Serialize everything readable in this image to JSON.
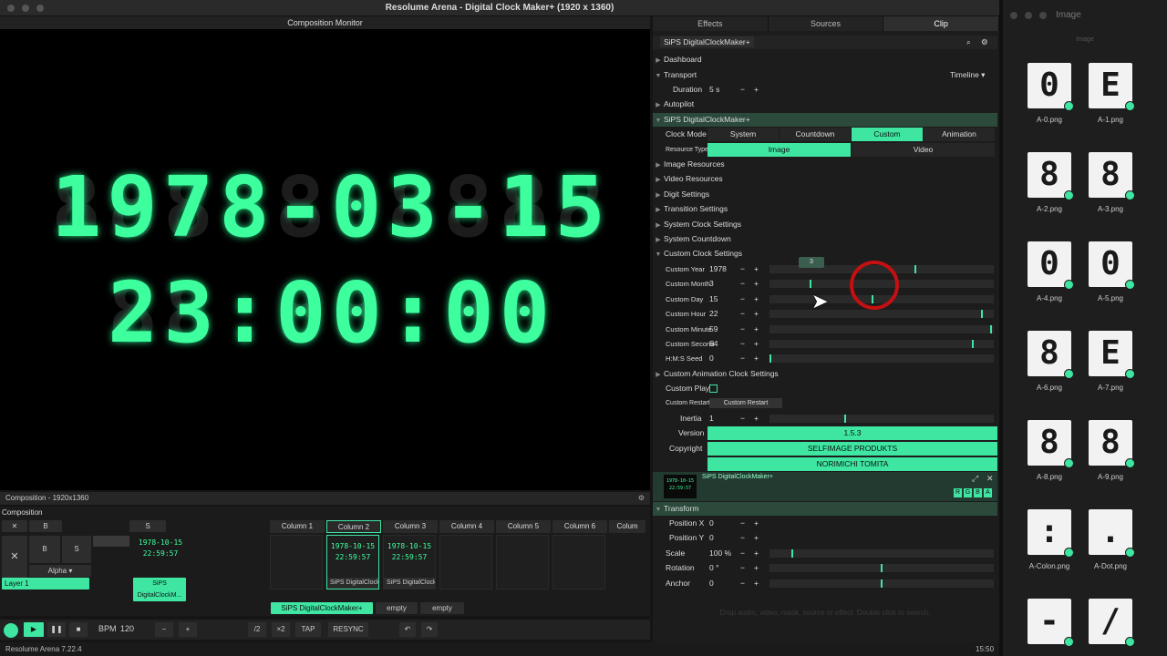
{
  "window_title": "Resolume Arena - Digital Clock Maker+ (1920 x 1360)",
  "monitor": {
    "title": "Composition Monitor",
    "line1": "1978-03-15",
    "line2": "23:00:00",
    "ghost1": "8888888888",
    "ghost2": "88:88:88"
  },
  "composition": {
    "header": "Composition - 1920x1360",
    "label": "Composition",
    "layer": "Layer 1",
    "blend": "Alpha"
  },
  "columns": [
    "Column 1",
    "Column 2",
    "Column 3",
    "Column 4",
    "Column 5",
    "Column 6",
    "Colum"
  ],
  "clips": [
    {
      "line1": "1978-10-15",
      "line2": "22:59:57",
      "name": "SiPS DigitalClockM..."
    },
    {
      "line1": "1978-10-15",
      "line2": "22:59:57",
      "name": "SiPS DigitalClock..."
    },
    {
      "line1": "1978-10-15",
      "line2": "22:59:57",
      "name": "SiPS DigitalClock..."
    }
  ],
  "deck_tabs": [
    "SiPS DigitalClockMaker+",
    "empty",
    "empty"
  ],
  "transport": {
    "bpm_label": "BPM",
    "bpm": "120",
    "half": "/2",
    "double": "×2",
    "tap": "TAP",
    "resync": "RESYNC"
  },
  "status": {
    "version": "Resolume Arena 7.22.4",
    "time": "15:50"
  },
  "right_tabs": [
    "Effects",
    "Sources",
    "Clip"
  ],
  "clip_panel": {
    "title": "SiPS DigitalClockMaker+",
    "dashboard": "Dashboard",
    "transport": "Transport",
    "timeline": "Timeline",
    "duration_label": "Duration",
    "duration": "5 s",
    "autopilot": "Autopilot",
    "plugin": "SiPS DigitalClockMaker+",
    "clock_mode_label": "Clock Mode",
    "clock_modes": [
      "System",
      "Countdown",
      "Custom",
      "Animation"
    ],
    "resource_type_label": "Resource Type",
    "resource_types": [
      "Image",
      "Video"
    ],
    "sections": [
      "Image Resources",
      "Video Resources",
      "Digit Settings",
      "Transition Settings",
      "System Clock Settings",
      "System Countdown",
      "Custom Clock Settings"
    ],
    "custom": [
      {
        "label": "Custom Year",
        "value": "1978",
        "level": 0.65
      },
      {
        "label": "Custom Month",
        "value": "3",
        "level": 0.18
      },
      {
        "label": "Custom Day",
        "value": "15",
        "level": 0.46
      },
      {
        "label": "Custom Hour",
        "value": "22",
        "level": 0.95
      },
      {
        "label": "Custom Minute",
        "value": "59",
        "level": 0.99
      },
      {
        "label": "Custom Second",
        "value": "54",
        "level": 0.91
      },
      {
        "label": "H:M:S Seed",
        "value": "0",
        "level": 0.0
      }
    ],
    "month_tooltip": "3",
    "anim_settings": "Custom Animation Clock Settings",
    "custom_play": "Custom Play",
    "custom_restart_label": "Custom Restart",
    "custom_restart_button": "Custom Restart",
    "inertia_label": "Inertia",
    "inertia": "1",
    "version_label": "Version",
    "version": "1.5.3",
    "copyright_label": "Copyright",
    "copyright1": "SELFIMAGE PRODUKTS",
    "copyright2": "NORIMICHI TOMITA",
    "plugin_strip": "SiPS DigitalClockMaker+",
    "rgba": [
      "R",
      "G",
      "B",
      "A"
    ],
    "transform": "Transform",
    "transform_rows": [
      {
        "label": "Position X",
        "value": "0"
      },
      {
        "label": "Position Y",
        "value": "0"
      },
      {
        "label": "Scale",
        "value": "100 %"
      },
      {
        "label": "Rotation",
        "value": "0 °"
      },
      {
        "label": "Anchor",
        "value": "0"
      }
    ],
    "drop_hint": "Drop audio, video, mask, source or effect. Double click to search."
  },
  "image_panel": {
    "title": "Image",
    "subtitle": "Image",
    "items": [
      {
        "name": "A-0.png",
        "glyph": "0"
      },
      {
        "name": "A-1.png",
        "glyph": "E"
      },
      {
        "name": "A-2.png",
        "glyph": "8"
      },
      {
        "name": "A-3.png",
        "glyph": "8"
      },
      {
        "name": "A-4.png",
        "glyph": "0"
      },
      {
        "name": "A-5.png",
        "glyph": "0"
      },
      {
        "name": "A-6.png",
        "glyph": "8"
      },
      {
        "name": "A-7.png",
        "glyph": "E"
      },
      {
        "name": "A-8.png",
        "glyph": "8"
      },
      {
        "name": "A-9.png",
        "glyph": "8"
      },
      {
        "name": "A-Colon.png",
        "glyph": ":"
      },
      {
        "name": "A-Dot.png",
        "glyph": "."
      },
      {
        "name": "",
        "glyph": "-"
      },
      {
        "name": "",
        "glyph": "/"
      }
    ]
  }
}
